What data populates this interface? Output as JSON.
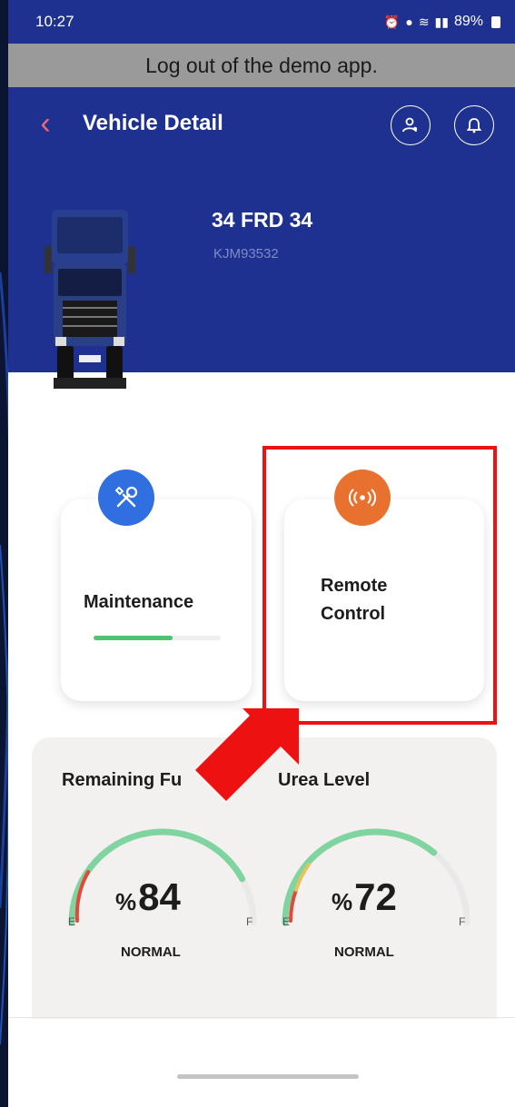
{
  "status_bar": {
    "time": "10:27",
    "battery": "89%"
  },
  "demo_banner": {
    "text": "Log out of the demo app."
  },
  "header": {
    "title": "Vehicle Detail"
  },
  "vehicle": {
    "plate": "34 FRD 34",
    "vin": "KJM93532"
  },
  "cards": {
    "maintenance": {
      "label": "Maintenance",
      "progress": 0.62
    },
    "remote_control": {
      "label_line1": "Remote",
      "label_line2": "Control"
    }
  },
  "gauges": {
    "fuel": {
      "title": "Remaining Fu",
      "percent_sign": "%",
      "value": "84",
      "status": "NORMAL",
      "empty_label": "E",
      "full_label": "F",
      "level": 0.84
    },
    "urea": {
      "title": "Urea Level",
      "percent_sign": "%",
      "value": "72",
      "status": "NORMAL",
      "empty_label": "E",
      "full_label": "F",
      "level": 0.72
    }
  },
  "colors": {
    "header_blue": "#1e3190",
    "maintenance_icon": "#2f6fe0",
    "remote_icon": "#e8712f",
    "gauge_green": "#7fd4a0",
    "highlight_red": "#ee1111"
  },
  "icons": {
    "back": "chevron-left-icon",
    "header_left": "person-gear-icon",
    "header_right": "bell-icon",
    "maintenance": "wrench-screwdriver-icon",
    "remote": "broadcast-icon"
  }
}
